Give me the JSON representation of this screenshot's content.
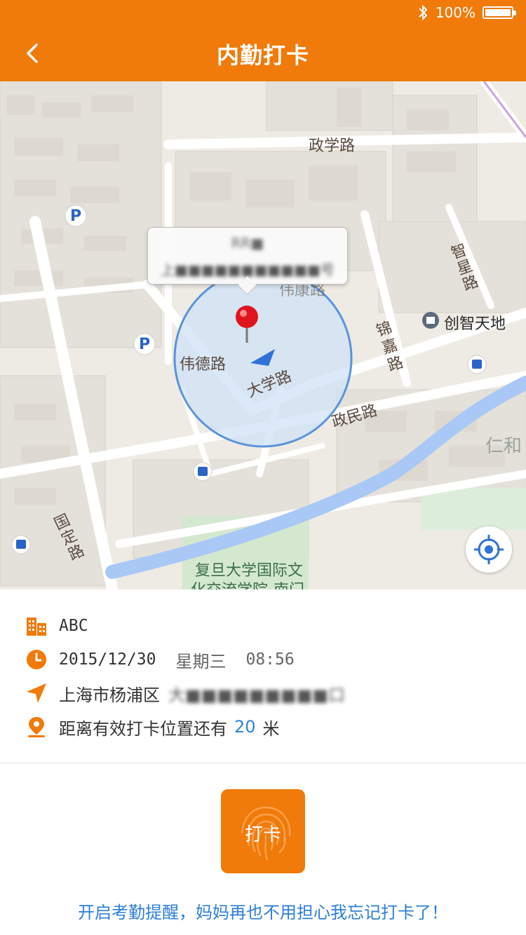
{
  "status_bar": {
    "battery_text": "100%",
    "icons": [
      "bluetooth-icon",
      "battery-icon"
    ]
  },
  "header": {
    "title": "内勤打卡",
    "back_icon": "chevron-left-icon"
  },
  "map": {
    "roads": {
      "zhengxue": "政学路",
      "zhixing": "智星路",
      "weide": "伟德路",
      "daxue": "大学路",
      "jinjia": "锦嘉路",
      "zhengmin": "政民路",
      "guoding": "国定路",
      "weikang": "伟康路"
    },
    "pois": {
      "chuangzhi": "创智天地",
      "renhe": "仁和",
      "fudan_line1": "复旦大学国际文",
      "fudan_line2": "化交流学院-南门"
    },
    "popup": {
      "line1": "RR■",
      "line2": "上■■■■■■■■■■■号"
    },
    "parking_label": "P",
    "locate_icon": "crosshair-icon",
    "colors": {
      "accuracy_circle": "#4a8fe0",
      "pin": "#e0141e",
      "river": "#a9c8f5"
    }
  },
  "info": {
    "company": "ABC",
    "date": "2015/12/30",
    "weekday": "星期三",
    "time": "08:56",
    "address_prefix": "上海市杨浦区",
    "address_blurred": "大■■■■■■■■■口",
    "distance_prefix": "距离有效打卡位置还有",
    "distance_value": "20",
    "distance_unit": "米",
    "icons": [
      "building-icon",
      "clock-icon",
      "navigation-arrow-icon",
      "location-pin-icon"
    ]
  },
  "punch_button": {
    "label": "打卡",
    "icon": "fingerprint-icon"
  },
  "reminder": "开启考勤提醒，妈妈再也不用担心我忘记打卡了！",
  "colors": {
    "brand_orange": "#f07a0a",
    "link_blue": "#2d7fd8"
  }
}
